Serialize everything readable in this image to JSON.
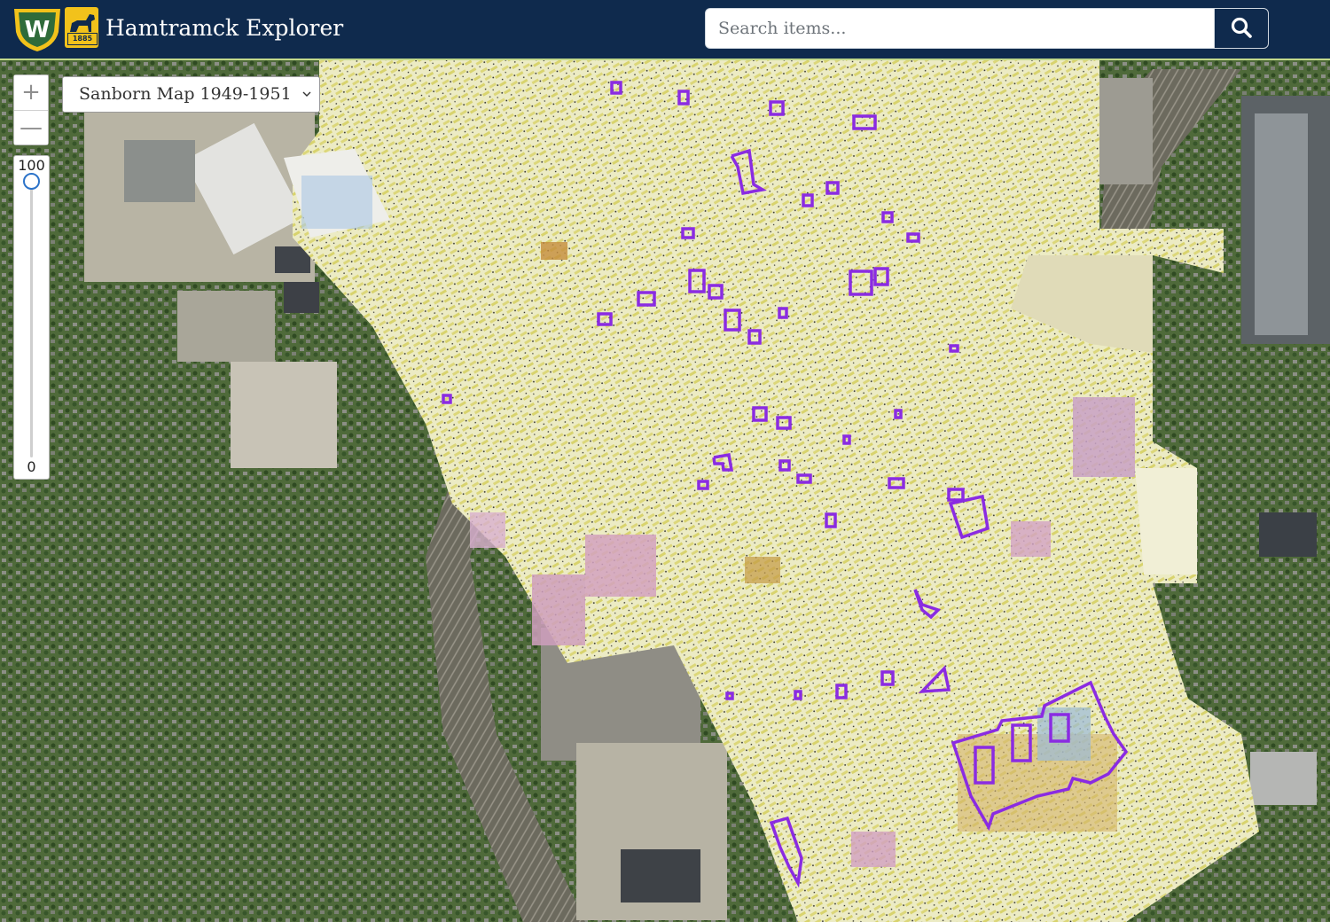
{
  "header": {
    "title": "Hamtramck Explorer",
    "logo_letter": "W",
    "badge_year": "1885"
  },
  "search": {
    "placeholder": "Search items...",
    "value": ""
  },
  "map": {
    "layer_select": {
      "selected": "Sanborn Map 1949-1951"
    },
    "zoom": {
      "in_label": "+",
      "out_label": "—"
    },
    "opacity": {
      "max_label": "100",
      "min_label": "0",
      "value": 100
    }
  },
  "colors": {
    "header_bg": "#0f2a4d",
    "logo_gold": "#f2c21b",
    "shield_green": "#2f6b3a",
    "highlight": "#8a2be2",
    "slider_accent": "#2c73c9"
  },
  "icons": {
    "search": "magnifier-icon",
    "dropdown": "chevron-down-icon"
  }
}
